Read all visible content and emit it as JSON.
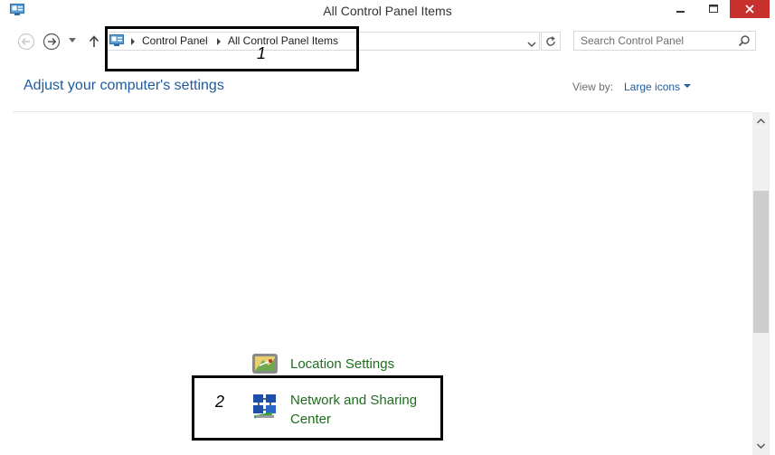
{
  "window": {
    "title": "All Control Panel Items"
  },
  "navigation": {
    "breadcrumb": [
      "Control Panel",
      "All Control Panel Items"
    ],
    "search_placeholder": "Search Control Panel"
  },
  "header": {
    "page_title": "Adjust your computer's settings",
    "view_by_label": "View by:",
    "view_by_value": "Large icons"
  },
  "items": [
    {
      "label": "Location Settings",
      "icon": "location-settings-icon"
    },
    {
      "label": "Network and Sharing Center",
      "icon": "network-sharing-icon"
    }
  ],
  "annotations": [
    {
      "number": "1"
    },
    {
      "number": "2"
    }
  ],
  "colors": {
    "link_blue": "#1e5a9c",
    "item_green": "#1f6c1f",
    "close_red": "#c7302b"
  }
}
